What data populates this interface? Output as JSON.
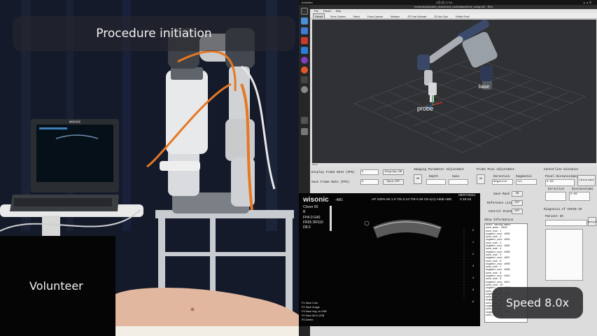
{
  "camera": {
    "procedure_label": "Procedure initiation",
    "subject_label": "Volunteer",
    "device_brand": "wisonic"
  },
  "topbar": {
    "activities": "Activities",
    "clock": "9月1日 17:51",
    "tray_icons": [
      "network-icon",
      "volume-icon",
      "power-icon"
    ]
  },
  "window": {
    "title": "/home/ubuntu/catkin_ws/src/robot_control/launch/rviz_config.rviz* - RViz",
    "menus": [
      "File",
      "Panels",
      "Help"
    ],
    "tools": [
      "Interact",
      "Move Camera",
      "Select",
      "Focus Camera",
      "Measure",
      "2D Pose Estimate",
      "2D Nav Goal",
      "Publish Point"
    ],
    "active_tool": "Interact",
    "status": "Reset",
    "rviz_labels": {
      "probe": "probe",
      "base": "base"
    }
  },
  "dock": {
    "icons": [
      "terminal-icon",
      "files-icon",
      "browser-icon",
      "app-icon",
      "vscode-icon",
      "chrome-icon",
      "firefox-icon",
      "rviz-icon",
      "settings-icon",
      "disk-icon",
      "trash-icon"
    ]
  },
  "gui": {
    "frame_rate": {
      "display_label": "Display Frame Rate (FPS)",
      "display_value": "5",
      "display_button": "Display-ON",
      "save_label": "Save Frame Rate (FPS)",
      "save_value": "5",
      "save_button": "Save-OFF"
    },
    "imaging": {
      "title": "Imaging Parameter Adjustment",
      "ok_button": "OK",
      "depth_label": "Depth",
      "gain_label": "Gain",
      "depth_value": "",
      "gain_value": ""
    },
    "probe_pose": {
      "title": "Probe Pose Adjustment",
      "ok_button": "OK",
      "direction_label": "Direction",
      "direction_value": "Negative",
      "segmental_label": "Segmental",
      "segmental_value": "xxx",
      "save_mask_label": "Save Mask",
      "save_mask_button": "ON",
      "reference_line_label": "Reference Line",
      "reference_line_button": "OFF",
      "control_point_label": "Control Point",
      "control_point_button": "OFF"
    },
    "centerline": {
      "title": "Centerline Distance",
      "pixel_label": "Pixel Distance(mm)",
      "pixel_value": "0.00",
      "calculate_button": "Calculate",
      "direction_label": "Direction",
      "direction_value": "",
      "distance_label": "Distance(mm)",
      "distance_value": "0.00"
    },
    "diagnosis": {
      "title": "Diagnosis of COVID-19",
      "patient_label": "Patient ID",
      "patient_value": "",
      "analyze_button": "Analyze"
    },
    "info": {
      "title": "Show Information",
      "lines": [
        "Start saving mask!",
        "save_mask: #003",
        "save_num: 1",
        "segment_num: #003",
        "save_num: 2",
        "segment_num: #004",
        "save_num: 3",
        "segment_num: #005",
        "save_num: 4",
        "segment_num: #006",
        "save_num: 5",
        "segment_num: #007",
        "save_num: 6",
        "segment_num: #008",
        "save_num: 7",
        "segment_num: #009",
        "save_num: 8",
        "segment_num: #010",
        "save_num: 9",
        "segment_num: #011",
        "save_num: 10",
        "segment_num: #012",
        "save_num: 11",
        "segment_num: #013",
        "save_num: 12",
        "segment_num: #014",
        "save_num: 13",
        "segment_num: #015",
        "save_num: 14",
        "segment_num: #016",
        "save_num: 15"
      ]
    }
  },
  "ultrasound": {
    "brand": "wisonic",
    "preset": "-AB1",
    "params": "AP 100% MI 1.0 TIS 0.13 TIB 0.49 C5-1(A) Adult ABD",
    "date": "09/07/2024",
    "time": "4:18:16",
    "probe": "Clover 60",
    "mode": "B",
    "line1": "FH4.0   G40",
    "line2": "FR55    DR116",
    "line3": "D8.0",
    "depth_ticks": [
      "0",
      "1",
      "2",
      "3",
      "4",
      "5",
      "6"
    ],
    "keys": [
      "F1  Save Cine",
      "F2  Save Image",
      "F3  Save Img. to USB",
      "F4  Save All to USB",
      "F5  Delete"
    ]
  },
  "playback": {
    "speed_label": "Speed 8.0x"
  }
}
